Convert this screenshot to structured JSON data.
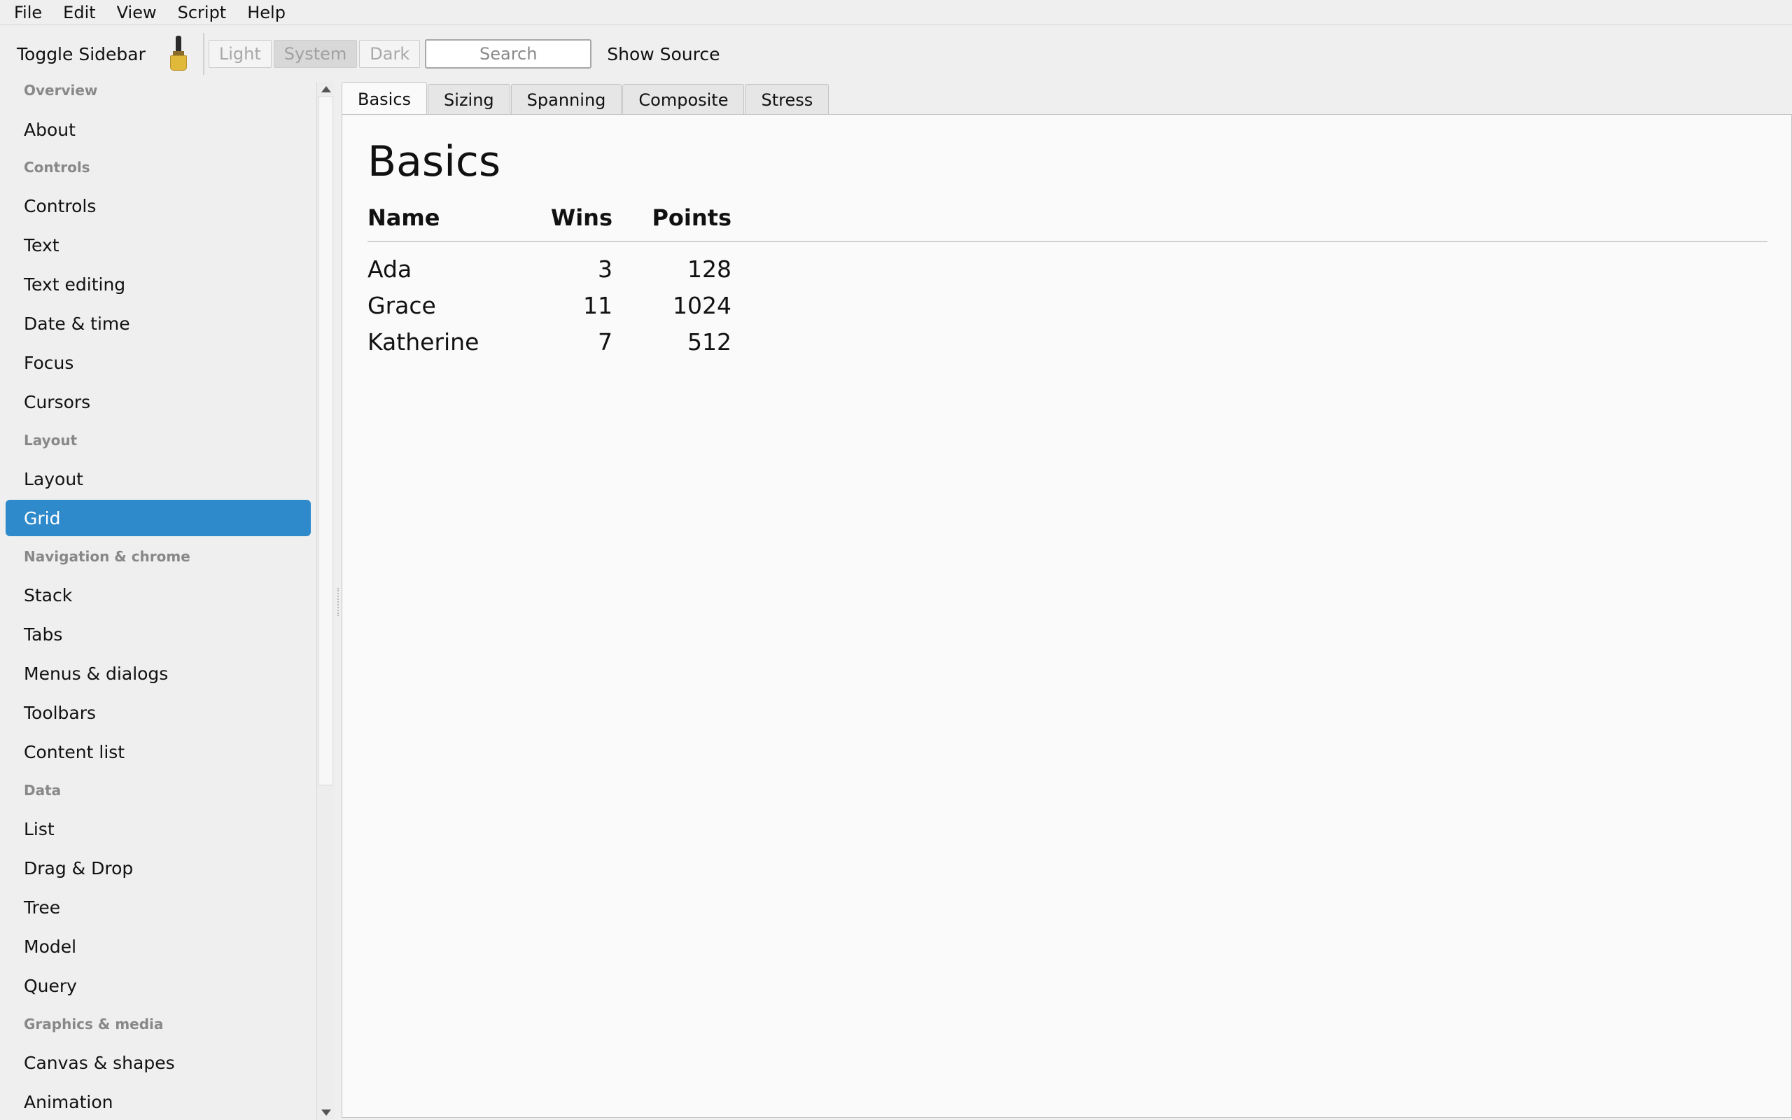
{
  "menubar": {
    "items": [
      "File",
      "Edit",
      "View",
      "Script",
      "Help"
    ]
  },
  "toolbar": {
    "toggle_sidebar": "Toggle Sidebar",
    "theme_buttons": [
      "Light",
      "System",
      "Dark"
    ],
    "search_placeholder": "Search",
    "show_source": "Show Source"
  },
  "sidebar": {
    "entries": [
      {
        "type": "group",
        "label": "Overview"
      },
      {
        "type": "item",
        "label": "About"
      },
      {
        "type": "group",
        "label": "Controls"
      },
      {
        "type": "item",
        "label": "Controls"
      },
      {
        "type": "item",
        "label": "Text"
      },
      {
        "type": "item",
        "label": "Text editing"
      },
      {
        "type": "item",
        "label": "Date & time"
      },
      {
        "type": "item",
        "label": "Focus"
      },
      {
        "type": "item",
        "label": "Cursors"
      },
      {
        "type": "group",
        "label": "Layout"
      },
      {
        "type": "item",
        "label": "Layout"
      },
      {
        "type": "item",
        "label": "Grid",
        "selected": true
      },
      {
        "type": "group",
        "label": "Navigation & chrome"
      },
      {
        "type": "item",
        "label": "Stack"
      },
      {
        "type": "item",
        "label": "Tabs"
      },
      {
        "type": "item",
        "label": "Menus & dialogs"
      },
      {
        "type": "item",
        "label": "Toolbars"
      },
      {
        "type": "item",
        "label": "Content list"
      },
      {
        "type": "group",
        "label": "Data"
      },
      {
        "type": "item",
        "label": "List"
      },
      {
        "type": "item",
        "label": "Drag & Drop"
      },
      {
        "type": "item",
        "label": "Tree"
      },
      {
        "type": "item",
        "label": "Model"
      },
      {
        "type": "item",
        "label": "Query"
      },
      {
        "type": "group",
        "label": "Graphics & media"
      },
      {
        "type": "item",
        "label": "Canvas & shapes"
      },
      {
        "type": "item",
        "label": "Animation"
      }
    ]
  },
  "tabs": [
    "Basics",
    "Sizing",
    "Spanning",
    "Composite",
    "Stress"
  ],
  "active_tab": "Basics",
  "content": {
    "title": "Basics",
    "columns": [
      "Name",
      "Wins",
      "Points"
    ],
    "rows": [
      [
        "Ada",
        "3",
        "128"
      ],
      [
        "Grace",
        "11",
        "1024"
      ],
      [
        "Katherine",
        "7",
        "512"
      ]
    ]
  },
  "colors": {
    "selection": "#2f8acb",
    "background": "#efefef",
    "panel": "#fafafa"
  }
}
